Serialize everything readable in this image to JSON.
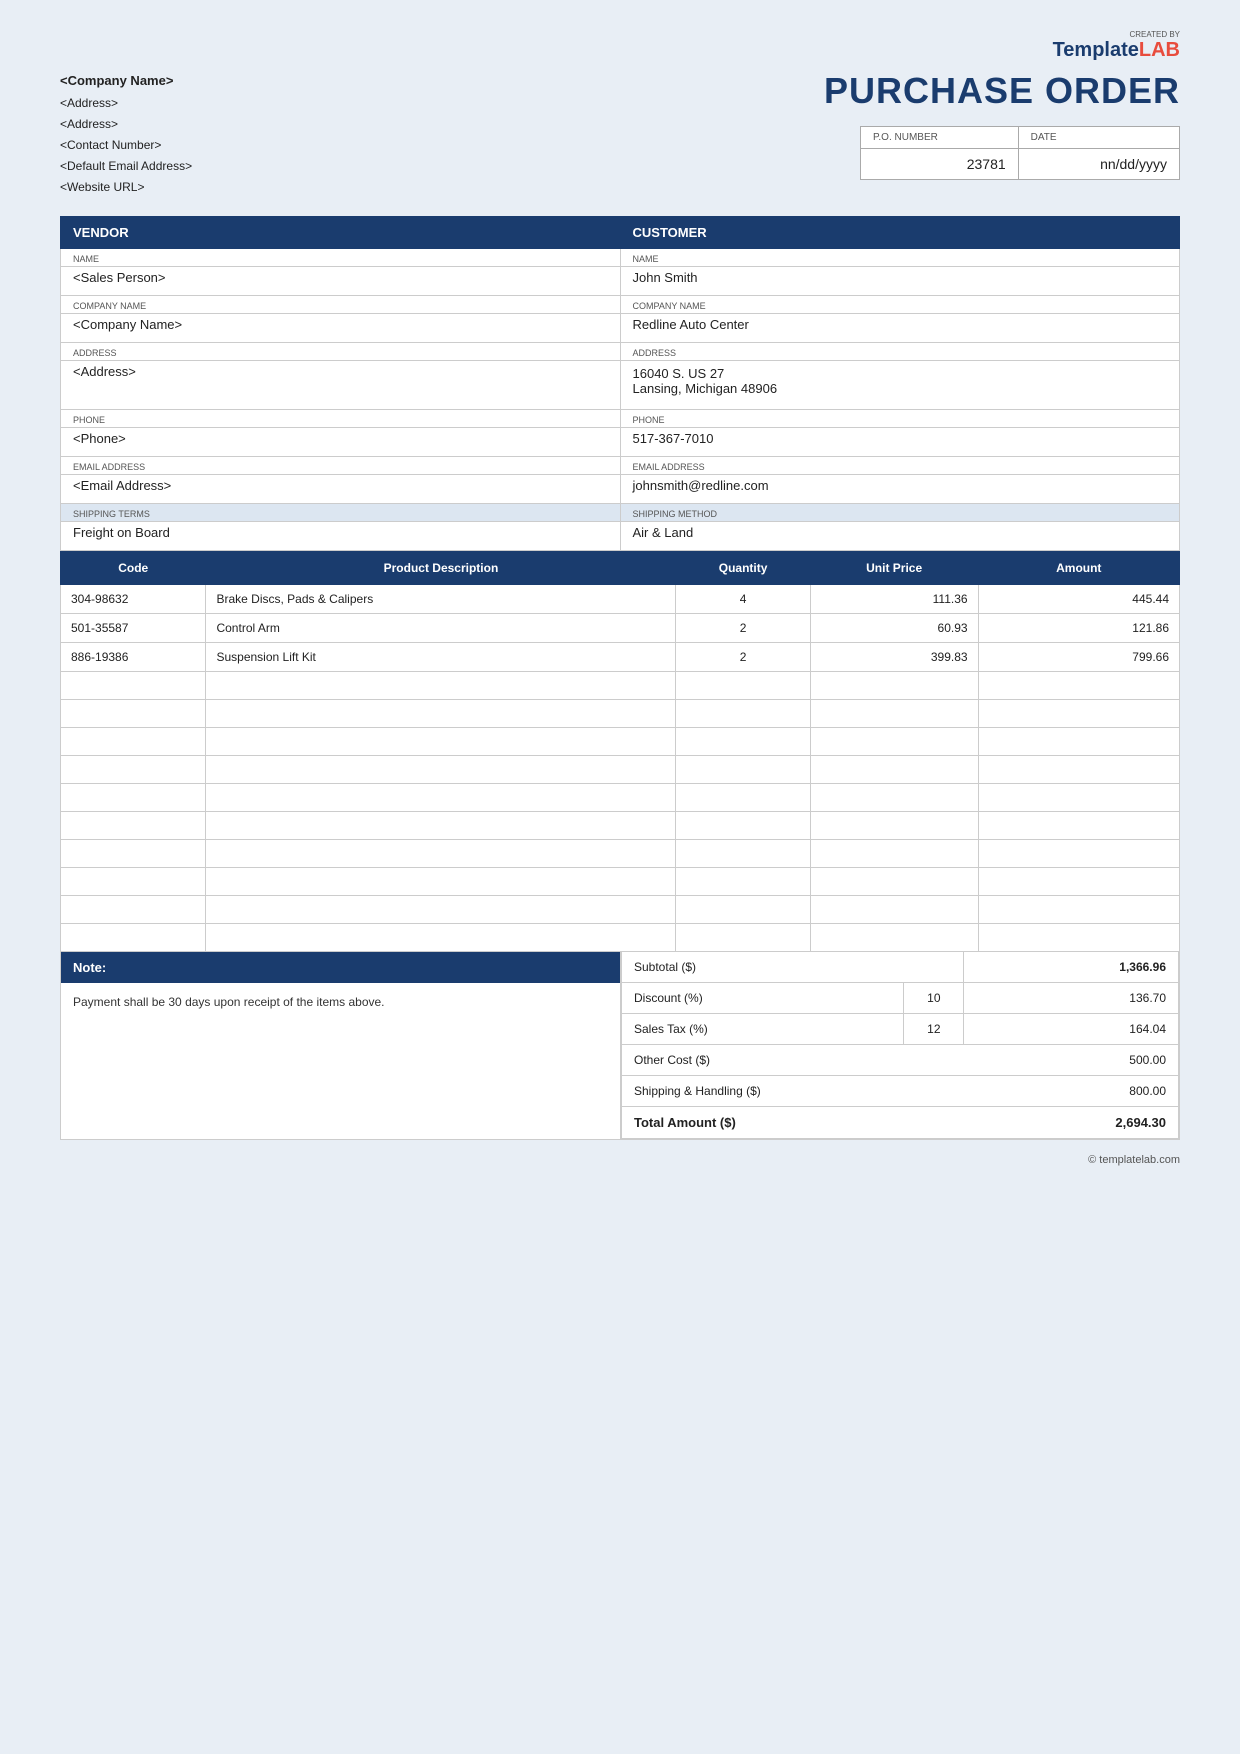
{
  "logo": {
    "created_by": "CREATED BY",
    "brand_template": "Template",
    "brand_lab": "LAB"
  },
  "company": {
    "name": "<Company Name>",
    "address1": "<Address>",
    "address2": "<Address>",
    "contact": "<Contact Number>",
    "email": "<Default Email Address>",
    "website": "<Website URL>"
  },
  "po": {
    "title": "PURCHASE ORDER",
    "po_number_label": "P.O. NUMBER",
    "date_label": "DATE",
    "po_number": "23781",
    "date": "nn/dd/yyyy"
  },
  "vendor": {
    "section_label": "VENDOR",
    "name_label": "NAME",
    "name": "<Sales Person>",
    "company_name_label": "COMPANY NAME",
    "company_name": "<Company Name>",
    "address_label": "ADDRESS",
    "address": "<Address>",
    "phone_label": "PHONE",
    "phone": "<Phone>",
    "email_label": "EMAIL ADDRESS",
    "email": "<Email Address>"
  },
  "customer": {
    "section_label": "CUSTOMER",
    "name_label": "NAME",
    "name": "John Smith",
    "company_name_label": "COMPANY NAME",
    "company_name": "Redline Auto Center",
    "address_label": "ADDRESS",
    "address": "16040 S. US 27\nLansing, Michigan 48906",
    "phone_label": "PHONE",
    "phone": "517-367-7010",
    "email_label": "EMAIL ADDRESS",
    "email": "johnsmith@redline.com"
  },
  "shipping": {
    "terms_label": "SHIPPING TERMS",
    "terms_value": "Freight on Board",
    "method_label": "SHIPPING METHOD",
    "method_value": "Air & Land"
  },
  "products": {
    "col_code": "Code",
    "col_description": "Product Description",
    "col_quantity": "Quantity",
    "col_unit_price": "Unit Price",
    "col_amount": "Amount",
    "items": [
      {
        "code": "304-98632",
        "description": "Brake Discs, Pads & Calipers",
        "quantity": "4",
        "unit_price": "111.36",
        "amount": "445.44"
      },
      {
        "code": "501-35587",
        "description": "Control Arm",
        "quantity": "2",
        "unit_price": "60.93",
        "amount": "121.86"
      },
      {
        "code": "886-19386",
        "description": "Suspension Lift Kit",
        "quantity": "2",
        "unit_price": "399.83",
        "amount": "799.66"
      }
    ],
    "empty_rows": 10
  },
  "note": {
    "label": "Note:",
    "content": "Payment shall be 30 days upon receipt of the items above."
  },
  "totals": {
    "subtotal_label": "Subtotal ($)",
    "subtotal_value": "1,366.96",
    "discount_label": "Discount (%)",
    "discount_pct": "10",
    "discount_value": "136.70",
    "sales_tax_label": "Sales Tax (%)",
    "sales_tax_pct": "12",
    "sales_tax_value": "164.04",
    "other_cost_label": "Other Cost ($)",
    "other_cost_value": "500.00",
    "shipping_label": "Shipping & Handling ($)",
    "shipping_value": "800.00",
    "total_label": "Total Amount ($)",
    "total_value": "2,694.30"
  },
  "footer": {
    "text": "© templatelab.com"
  }
}
